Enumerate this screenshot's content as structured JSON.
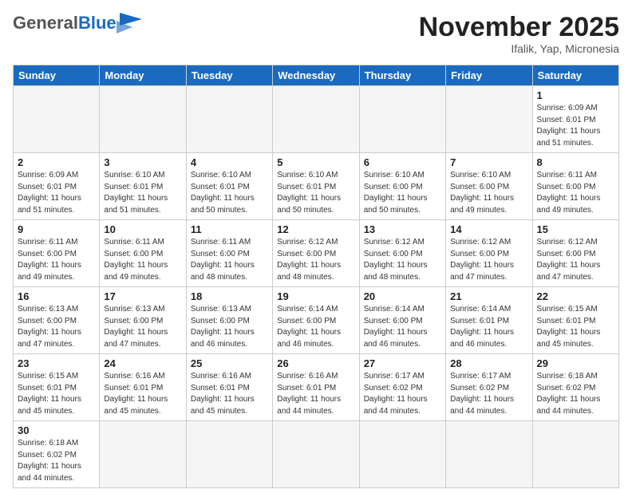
{
  "header": {
    "logo_general": "General",
    "logo_blue": "Blue",
    "month_title": "November 2025",
    "subtitle": "Ifalik, Yap, Micronesia"
  },
  "days_of_week": [
    "Sunday",
    "Monday",
    "Tuesday",
    "Wednesday",
    "Thursday",
    "Friday",
    "Saturday"
  ],
  "weeks": [
    [
      {
        "day": "",
        "info": ""
      },
      {
        "day": "",
        "info": ""
      },
      {
        "day": "",
        "info": ""
      },
      {
        "day": "",
        "info": ""
      },
      {
        "day": "",
        "info": ""
      },
      {
        "day": "",
        "info": ""
      },
      {
        "day": "1",
        "info": "Sunrise: 6:09 AM\nSunset: 6:01 PM\nDaylight: 11 hours\nand 51 minutes."
      }
    ],
    [
      {
        "day": "2",
        "info": "Sunrise: 6:09 AM\nSunset: 6:01 PM\nDaylight: 11 hours\nand 51 minutes."
      },
      {
        "day": "3",
        "info": "Sunrise: 6:10 AM\nSunset: 6:01 PM\nDaylight: 11 hours\nand 51 minutes."
      },
      {
        "day": "4",
        "info": "Sunrise: 6:10 AM\nSunset: 6:01 PM\nDaylight: 11 hours\nand 50 minutes."
      },
      {
        "day": "5",
        "info": "Sunrise: 6:10 AM\nSunset: 6:01 PM\nDaylight: 11 hours\nand 50 minutes."
      },
      {
        "day": "6",
        "info": "Sunrise: 6:10 AM\nSunset: 6:00 PM\nDaylight: 11 hours\nand 50 minutes."
      },
      {
        "day": "7",
        "info": "Sunrise: 6:10 AM\nSunset: 6:00 PM\nDaylight: 11 hours\nand 49 minutes."
      },
      {
        "day": "8",
        "info": "Sunrise: 6:11 AM\nSunset: 6:00 PM\nDaylight: 11 hours\nand 49 minutes."
      }
    ],
    [
      {
        "day": "9",
        "info": "Sunrise: 6:11 AM\nSunset: 6:00 PM\nDaylight: 11 hours\nand 49 minutes."
      },
      {
        "day": "10",
        "info": "Sunrise: 6:11 AM\nSunset: 6:00 PM\nDaylight: 11 hours\nand 49 minutes."
      },
      {
        "day": "11",
        "info": "Sunrise: 6:11 AM\nSunset: 6:00 PM\nDaylight: 11 hours\nand 48 minutes."
      },
      {
        "day": "12",
        "info": "Sunrise: 6:12 AM\nSunset: 6:00 PM\nDaylight: 11 hours\nand 48 minutes."
      },
      {
        "day": "13",
        "info": "Sunrise: 6:12 AM\nSunset: 6:00 PM\nDaylight: 11 hours\nand 48 minutes."
      },
      {
        "day": "14",
        "info": "Sunrise: 6:12 AM\nSunset: 6:00 PM\nDaylight: 11 hours\nand 47 minutes."
      },
      {
        "day": "15",
        "info": "Sunrise: 6:12 AM\nSunset: 6:00 PM\nDaylight: 11 hours\nand 47 minutes."
      }
    ],
    [
      {
        "day": "16",
        "info": "Sunrise: 6:13 AM\nSunset: 6:00 PM\nDaylight: 11 hours\nand 47 minutes."
      },
      {
        "day": "17",
        "info": "Sunrise: 6:13 AM\nSunset: 6:00 PM\nDaylight: 11 hours\nand 47 minutes."
      },
      {
        "day": "18",
        "info": "Sunrise: 6:13 AM\nSunset: 6:00 PM\nDaylight: 11 hours\nand 46 minutes."
      },
      {
        "day": "19",
        "info": "Sunrise: 6:14 AM\nSunset: 6:00 PM\nDaylight: 11 hours\nand 46 minutes."
      },
      {
        "day": "20",
        "info": "Sunrise: 6:14 AM\nSunset: 6:00 PM\nDaylight: 11 hours\nand 46 minutes."
      },
      {
        "day": "21",
        "info": "Sunrise: 6:14 AM\nSunset: 6:01 PM\nDaylight: 11 hours\nand 46 minutes."
      },
      {
        "day": "22",
        "info": "Sunrise: 6:15 AM\nSunset: 6:01 PM\nDaylight: 11 hours\nand 45 minutes."
      }
    ],
    [
      {
        "day": "23",
        "info": "Sunrise: 6:15 AM\nSunset: 6:01 PM\nDaylight: 11 hours\nand 45 minutes."
      },
      {
        "day": "24",
        "info": "Sunrise: 6:16 AM\nSunset: 6:01 PM\nDaylight: 11 hours\nand 45 minutes."
      },
      {
        "day": "25",
        "info": "Sunrise: 6:16 AM\nSunset: 6:01 PM\nDaylight: 11 hours\nand 45 minutes."
      },
      {
        "day": "26",
        "info": "Sunrise: 6:16 AM\nSunset: 6:01 PM\nDaylight: 11 hours\nand 44 minutes."
      },
      {
        "day": "27",
        "info": "Sunrise: 6:17 AM\nSunset: 6:02 PM\nDaylight: 11 hours\nand 44 minutes."
      },
      {
        "day": "28",
        "info": "Sunrise: 6:17 AM\nSunset: 6:02 PM\nDaylight: 11 hours\nand 44 minutes."
      },
      {
        "day": "29",
        "info": "Sunrise: 6:18 AM\nSunset: 6:02 PM\nDaylight: 11 hours\nand 44 minutes."
      }
    ],
    [
      {
        "day": "30",
        "info": "Sunrise: 6:18 AM\nSunset: 6:02 PM\nDaylight: 11 hours\nand 44 minutes."
      },
      {
        "day": "",
        "info": ""
      },
      {
        "day": "",
        "info": ""
      },
      {
        "day": "",
        "info": ""
      },
      {
        "day": "",
        "info": ""
      },
      {
        "day": "",
        "info": ""
      },
      {
        "day": "",
        "info": ""
      }
    ]
  ]
}
